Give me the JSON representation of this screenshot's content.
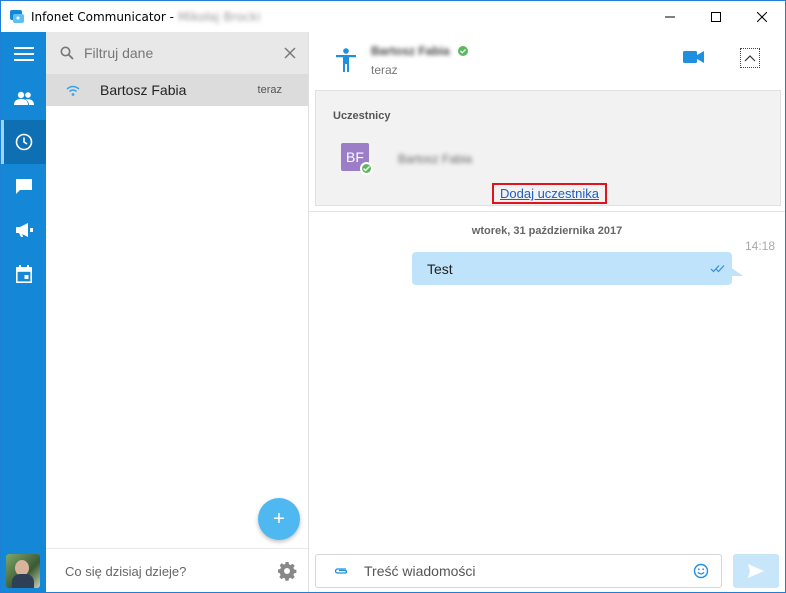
{
  "window": {
    "title": "Infonet Communicator -",
    "user": "Mikołaj Brocki"
  },
  "sidebar": {
    "items": [
      {
        "icon": "menu-icon"
      },
      {
        "icon": "contacts-icon"
      },
      {
        "icon": "recent-clock-icon",
        "active": true
      },
      {
        "icon": "chat-icon"
      },
      {
        "icon": "megaphone-icon"
      },
      {
        "icon": "calendar-icon"
      }
    ]
  },
  "conversations": {
    "filter_placeholder": "Filtruj dane",
    "items": [
      {
        "name": "Bartosz Fabia",
        "time": "teraz"
      }
    ],
    "status_placeholder": "Co się dzisiaj dzieje?",
    "fab_label": "+"
  },
  "chat": {
    "header": {
      "name": "Bartosz Fabia",
      "status": "teraz"
    },
    "participants": {
      "title": "Uczestnicy",
      "list": [
        {
          "initials": "BF",
          "name": "Bartosz Fabia"
        }
      ],
      "add_link": "Dodaj uczestnika"
    },
    "date_separator": "wtorek, 31 października 2017",
    "messages": [
      {
        "text": "Test",
        "time": "14:18"
      }
    ],
    "composer_placeholder": "Treść wiadomości"
  },
  "colors": {
    "accent": "#1487d6",
    "bubble": "#bfe3fa",
    "highlight": "#e0141f"
  }
}
